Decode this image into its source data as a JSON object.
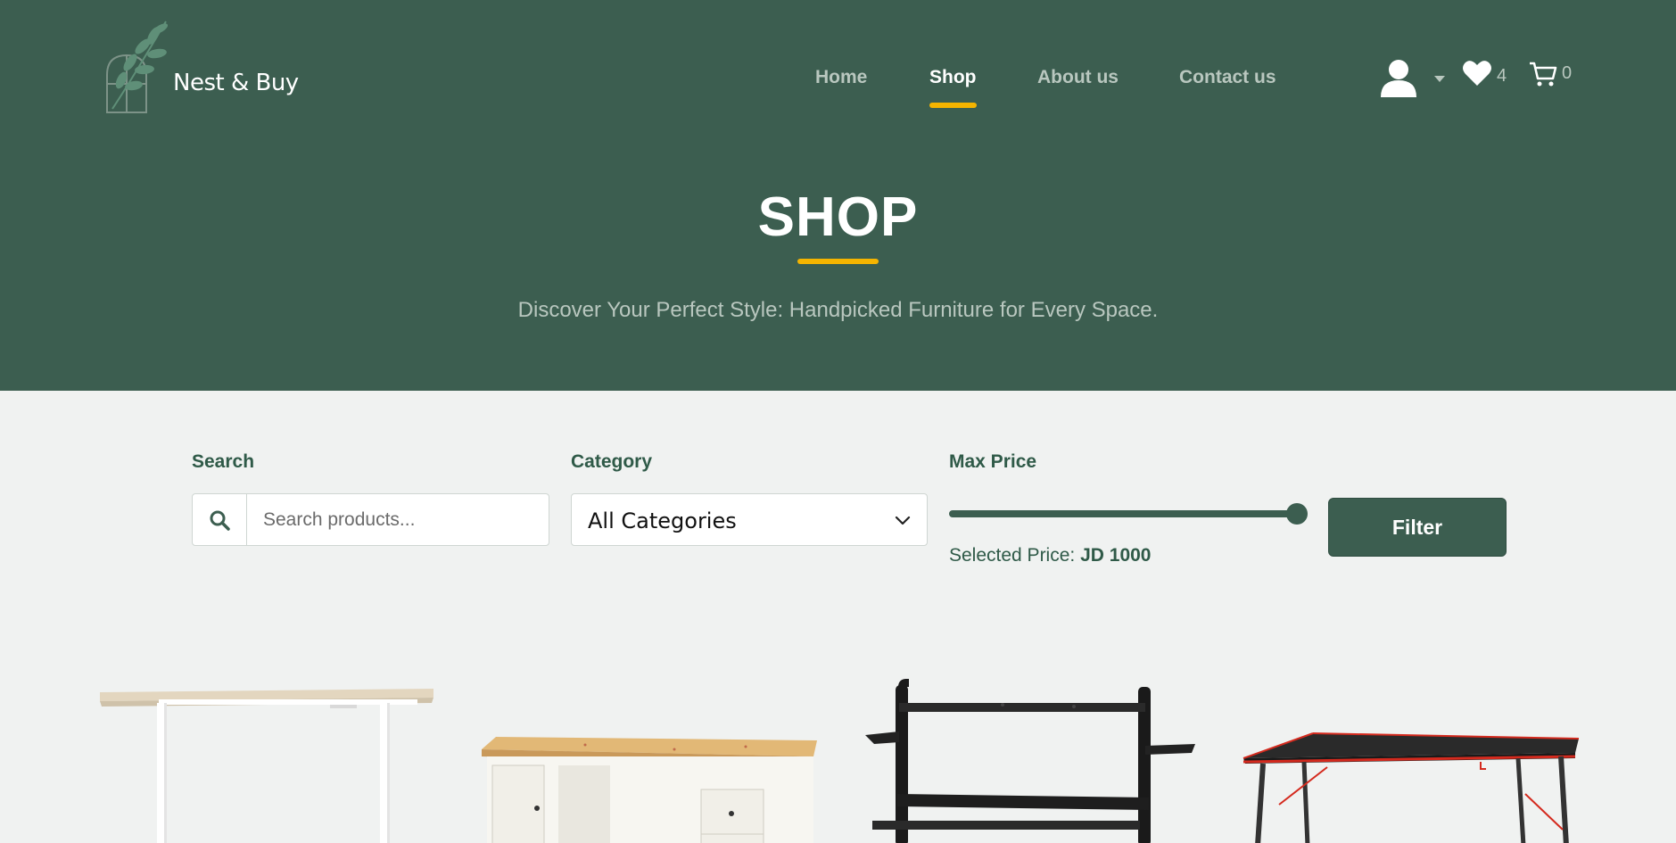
{
  "brand": {
    "name": "Nest & Buy"
  },
  "nav": {
    "items": [
      {
        "label": "Home",
        "active": false
      },
      {
        "label": "Shop",
        "active": true
      },
      {
        "label": "About us",
        "active": false
      },
      {
        "label": "Contact us",
        "active": false
      }
    ]
  },
  "header_icons": {
    "user": "user-icon",
    "dropdown": "caret-down-icon",
    "wishlist": {
      "icon": "heart-icon",
      "count": "4"
    },
    "cart": {
      "icon": "cart-icon",
      "count": "0"
    }
  },
  "hero": {
    "title": "SHOP",
    "subtitle": "Discover Your Perfect Style: Handpicked Furniture for Every Space."
  },
  "filters": {
    "search": {
      "label": "Search",
      "placeholder": "Search products...",
      "value": ""
    },
    "category": {
      "label": "Category",
      "selected": "All Categories"
    },
    "max_price": {
      "label": "Max Price",
      "selected_prefix": "Selected Price:",
      "selected_value": "JD 1000",
      "level": 1.0
    },
    "button_label": "Filter"
  },
  "products": [
    {
      "image": "standing-desk-image"
    },
    {
      "image": "wood-top-desk-image"
    },
    {
      "image": "gaming-desk-black-image"
    },
    {
      "image": "gaming-desk-red-image"
    }
  ],
  "colors": {
    "brand_green": "#3c5e50",
    "accent_yellow": "#f5b400",
    "background": "#f0f2f1",
    "nav_inactive": "#b9c7bf"
  }
}
